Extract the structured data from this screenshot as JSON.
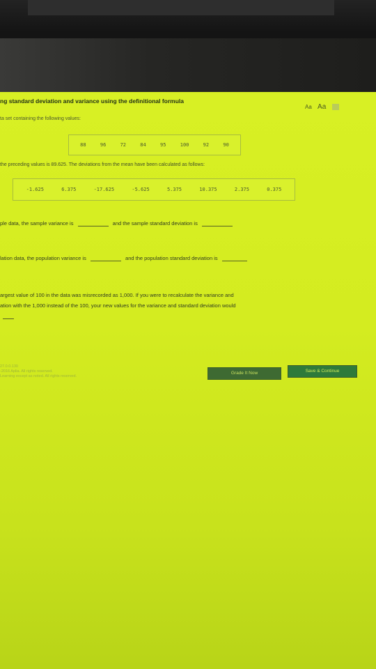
{
  "header": {
    "title": "ng standard deviation and variance using the definitional formula",
    "font_small": "Aa",
    "font_large": "Aa"
  },
  "intro_text": "ta set containing the following values:",
  "values": [
    "88",
    "96",
    "72",
    "84",
    "95",
    "100",
    "92",
    "90"
  ],
  "mean_text": "the preceding values is 89.625. The deviations from the mean have been calculated as follows:",
  "deviations": [
    "-1.625",
    "6.375",
    "-17.625",
    "-5.625",
    "5.375",
    "10.375",
    "2.375",
    "0.375"
  ],
  "questions": {
    "sample_a": "ple data, the sample variance is",
    "sample_b": "and the sample standard deviation is",
    "pop_a": "lation data, the population variance is",
    "pop_b": "and the population standard deviation is",
    "misrecord_line1": "argest value of 100 in the data was misrecorded as 1,000. If you were to recalculate the variance and",
    "misrecord_line2": "ation with the 1,000 instead of the 100, your new values for the variance and standard deviation would"
  },
  "buttons": {
    "grade": "Grade It Now",
    "save": "Save & Continue"
  },
  "footer": {
    "line1": "27.0.0.130",
    "line2": "-2016 Aplia. All rights reserved.",
    "line3": "Learning except as noted. All rights reserved."
  }
}
